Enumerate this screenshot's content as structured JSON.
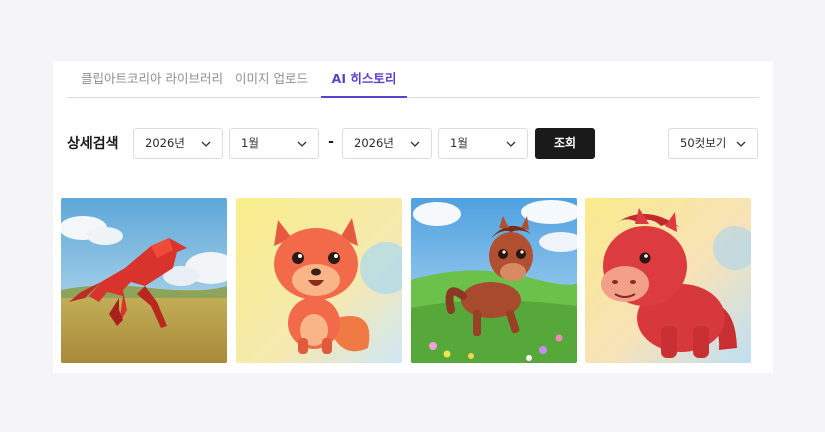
{
  "tabs": [
    {
      "label": "클립아트코리아 라이브러리",
      "active": false
    },
    {
      "label": "이미지 업로드",
      "active": false
    },
    {
      "label": "AI 히스토리",
      "active": true
    }
  ],
  "search": {
    "label": "상세검색",
    "start_year": "2026년",
    "start_month": "1월",
    "separator": "-",
    "end_year": "2026년",
    "end_month": "1월",
    "submit_label": "조회",
    "page_size": "50컷보기"
  },
  "accent_color": "#5b3fd1",
  "images": [
    {
      "icon": "origami-horse-image"
    },
    {
      "icon": "cartoon-fox-image"
    },
    {
      "icon": "cartoon-pony-image"
    },
    {
      "icon": "clay-horse-image"
    }
  ]
}
